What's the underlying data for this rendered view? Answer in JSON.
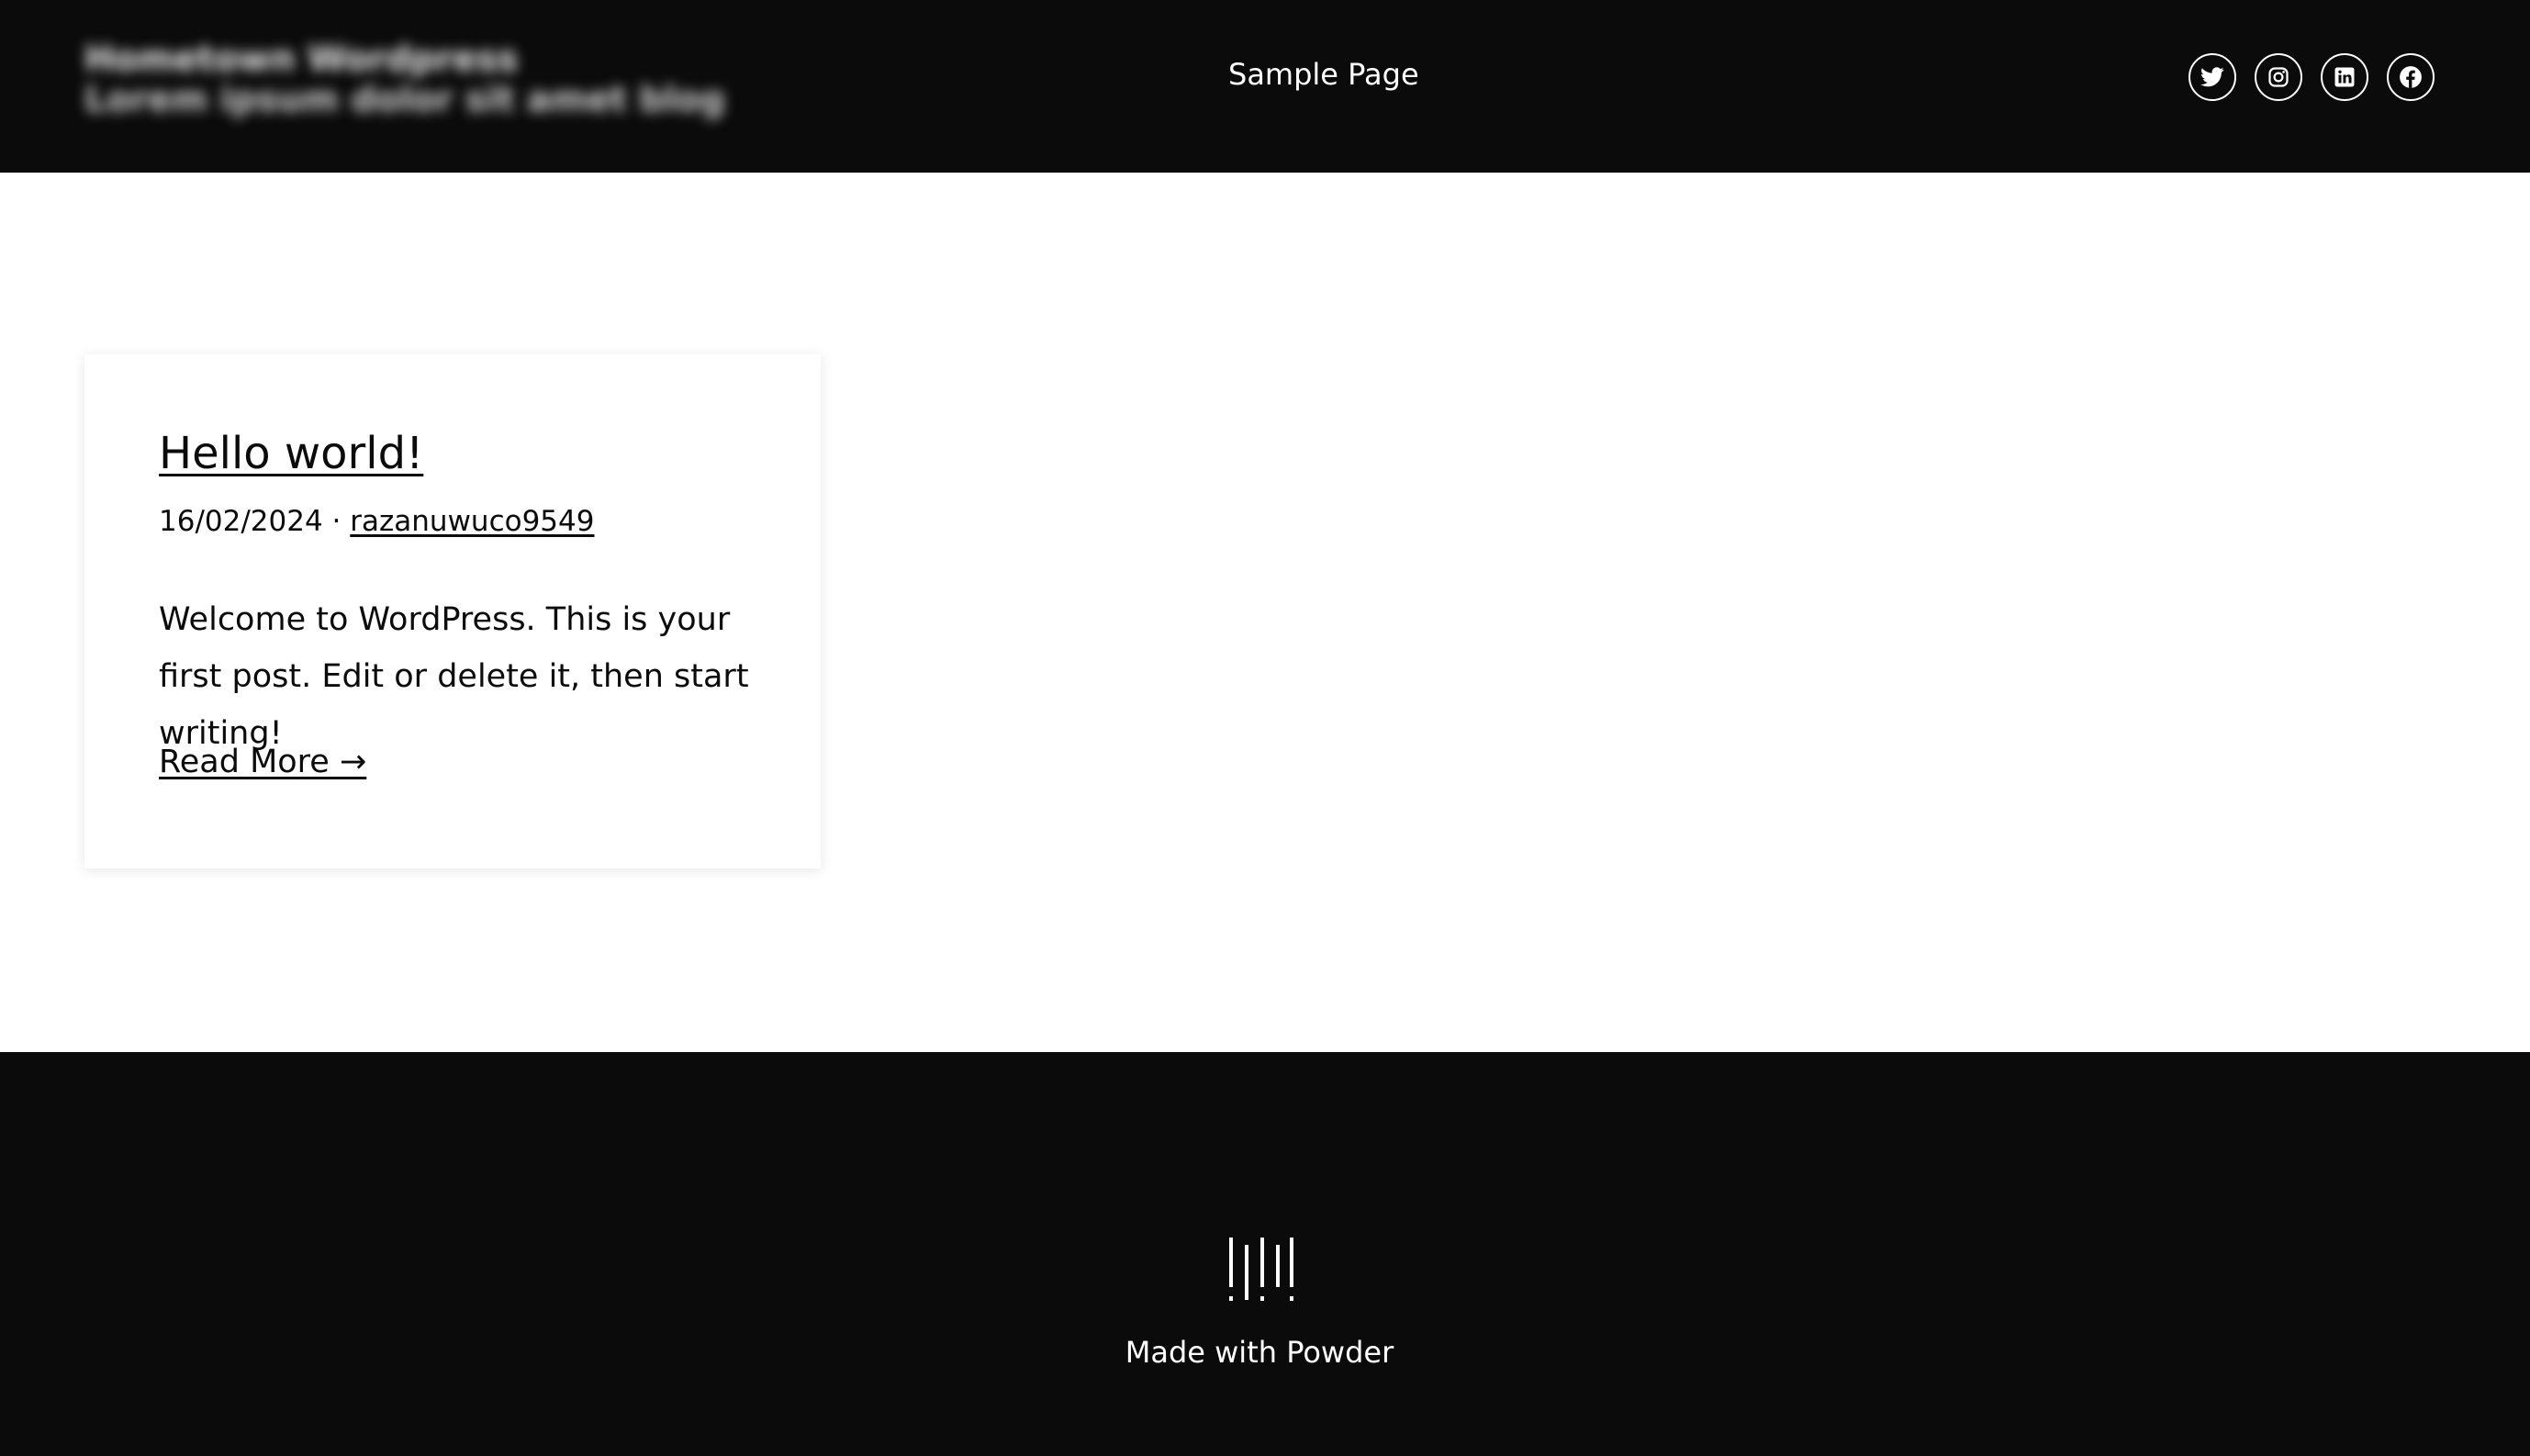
{
  "header": {
    "site_title": "Hometown Wordpress",
    "site_tagline": "Lorem ipsum dolor sit amet blog",
    "nav": [
      {
        "label": "Sample Page"
      }
    ],
    "social_icons": [
      "twitter-icon",
      "instagram-icon",
      "linkedin-icon",
      "facebook-icon"
    ]
  },
  "post": {
    "title": "Hello world!",
    "date": "16/02/2024",
    "separator": "·",
    "author": "razanuwuco9549",
    "excerpt": "Welcome to WordPress. This is your first post. Edit or delete it, then start writing!",
    "read_more": "Read More →"
  },
  "footer": {
    "logo_icon": "powder-logo-icon",
    "credit": "Made with Powder"
  },
  "colors": {
    "header_bg": "#0b0b0b",
    "footer_bg": "#0b0b0b",
    "page_bg": "#ffffff",
    "text": "#0b0b0b",
    "inverse_text": "#ffffff"
  }
}
